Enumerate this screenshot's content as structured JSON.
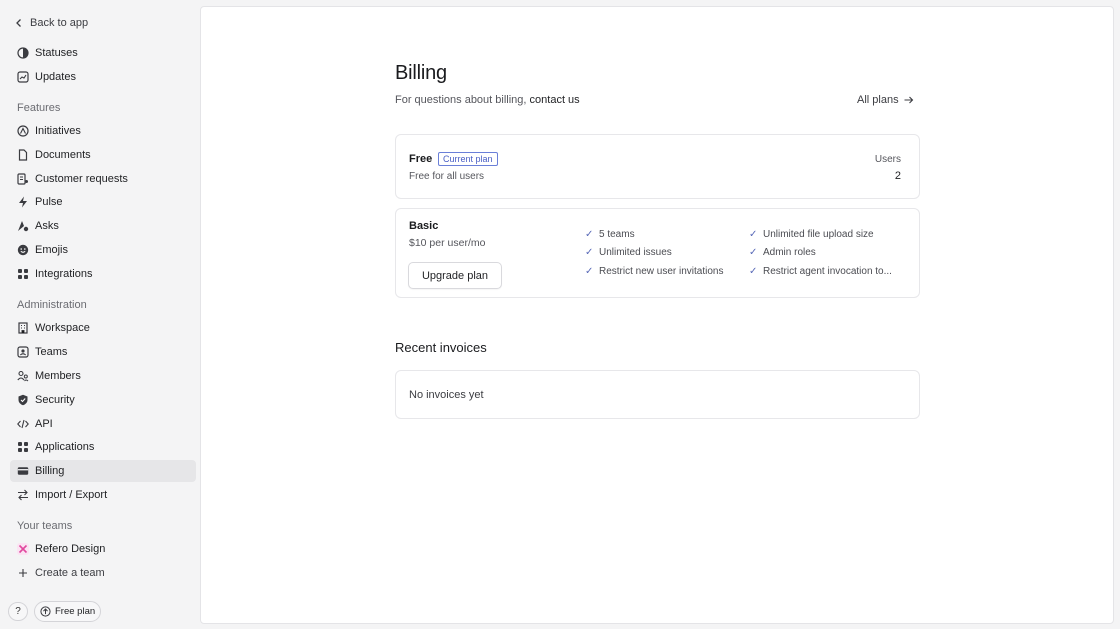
{
  "sidebar": {
    "back_label": "Back to app",
    "top_items": [
      {
        "label": "Statuses",
        "icon": "status-icon"
      },
      {
        "label": "Updates",
        "icon": "chart-icon"
      }
    ],
    "features_label": "Features",
    "features": [
      {
        "label": "Initiatives",
        "icon": "initiatives-icon"
      },
      {
        "label": "Documents",
        "icon": "document-icon"
      },
      {
        "label": "Customer requests",
        "icon": "customer-requests-icon"
      },
      {
        "label": "Pulse",
        "icon": "pulse-icon"
      },
      {
        "label": "Asks",
        "icon": "asks-icon"
      },
      {
        "label": "Emojis",
        "icon": "emoji-icon"
      },
      {
        "label": "Integrations",
        "icon": "grid-icon"
      }
    ],
    "admin_label": "Administration",
    "admin": [
      {
        "label": "Workspace",
        "icon": "building-icon"
      },
      {
        "label": "Teams",
        "icon": "team-icon"
      },
      {
        "label": "Members",
        "icon": "members-icon"
      },
      {
        "label": "Security",
        "icon": "shield-icon"
      },
      {
        "label": "API",
        "icon": "code-icon"
      },
      {
        "label": "Applications",
        "icon": "grid-icon"
      },
      {
        "label": "Billing",
        "icon": "card-icon"
      },
      {
        "label": "Import / Export",
        "icon": "swap-icon"
      }
    ],
    "teams_label": "Your teams",
    "team_name": "Refero Design",
    "create_team": "Create a team",
    "help_label": "?",
    "plan_label": "Free plan"
  },
  "billing": {
    "title": "Billing",
    "subtitle_prefix": "For questions about billing,",
    "contact_link": "contact us",
    "all_plans": "All plans",
    "free_plan": {
      "name": "Free",
      "badge": "Current plan",
      "description": "Free for all users",
      "users_label": "Users",
      "users_count": "2"
    },
    "basic_plan": {
      "name": "Basic",
      "price": "$10 per user/mo",
      "upgrade_label": "Upgrade plan",
      "features_col1": [
        "5 teams",
        "Unlimited issues",
        "Restrict new user invitations"
      ],
      "features_col2": [
        "Unlimited file upload size",
        "Admin roles",
        "Restrict agent invocation to..."
      ]
    },
    "invoices_title": "Recent invoices",
    "invoices_empty": "No invoices yet"
  },
  "colors": {
    "accent": "#4a5fc4",
    "team_badge": "#e0489e"
  }
}
